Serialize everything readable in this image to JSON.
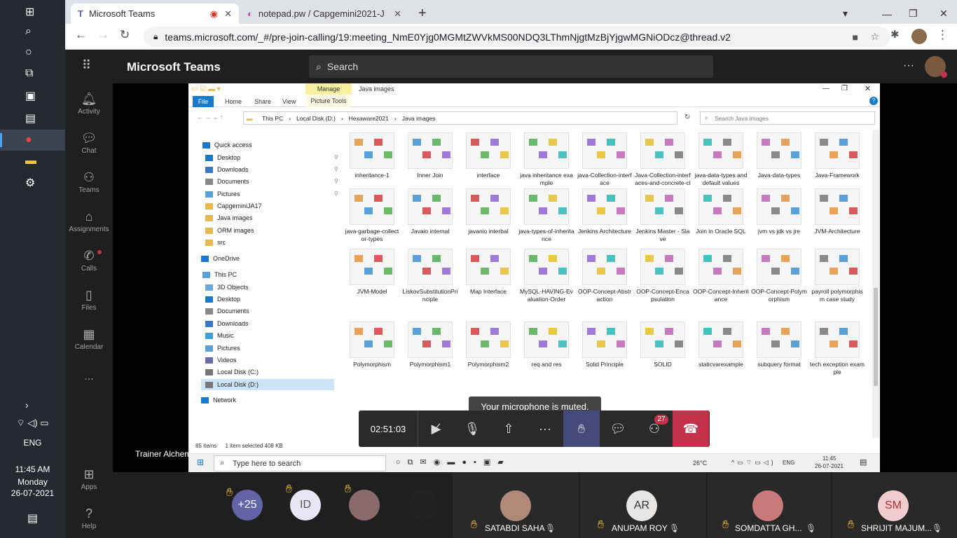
{
  "win_tray": {
    "lang": "ENG",
    "time": "11:45 AM",
    "day": "Monday",
    "date": "26-07-2021"
  },
  "chrome": {
    "tabs": [
      {
        "label": "Microsoft Teams"
      },
      {
        "label": "notepad.pw / Capgemini2021-JA"
      }
    ],
    "url": "teams.microsoft.com/_#/pre-join-calling/19:meeting_NmE0Yjg0MGMtZWVkMS00NDQ3LThmNjgtMzBjYjgwMGNiODcz@thread.v2"
  },
  "teams": {
    "brand": "Microsoft Teams",
    "search_placeholder": "Search",
    "rail": [
      {
        "label": "Activity"
      },
      {
        "label": "Chat"
      },
      {
        "label": "Teams"
      },
      {
        "label": "Assignments"
      },
      {
        "label": "Calls"
      },
      {
        "label": "Files"
      },
      {
        "label": "Calendar"
      },
      {
        "label": "..."
      },
      {
        "label": "Apps"
      },
      {
        "label": "Help"
      }
    ],
    "presenter": "Trainer Alchemy"
  },
  "explorer": {
    "ribbon_context": "Manage",
    "ribbon_title": "Java  images",
    "ribbon_tabs": [
      "File",
      "Home",
      "Share",
      "View",
      "Picture Tools"
    ],
    "breadcrumb": [
      "This PC",
      "Local Disk (D:)",
      "Hexaware2021",
      "Java  images"
    ],
    "search_placeholder": "Search Java  images",
    "nav": [
      "Quick access",
      "Desktop",
      "Downloads",
      "Documents",
      "Pictures",
      "CapgeminiJA17",
      "Java  images",
      "ORM images",
      "src",
      "OneDrive",
      "This PC",
      "3D Objects",
      "Desktop",
      "Documents",
      "Downloads",
      "Music",
      "Pictures",
      "Videos",
      "Local Disk (C:)",
      "Local Disk (D:)",
      "Network"
    ],
    "files": [
      "inheritance-1",
      "Inner Join",
      "interface",
      "java inheritance example",
      "java-Collection-interface",
      "Java-Collection-interfaces-and-concrete-classes",
      "java-data-types and default values",
      "Java-data-types",
      "Java-Framework",
      "java-garbage-collector-types",
      "Javaio internal",
      "javanio interbal",
      "java-types-of-inheritance",
      "Jenkins Architecture",
      "Jenkins Master - Slave",
      "Join in Oracle SQL",
      "jvm vs jdk vs jre",
      "JVM-Architecture",
      "JVM-Model",
      "LiskovSubstitutionPrinciple",
      "Map Interface",
      "MySQL-HAVING-Evaluation-Order",
      "OOP-Concept-Abstraction",
      "OOP-Concept-Encapsulation",
      "OOP-Concept-Inheritance",
      "OOP-Concept-Polymorphism",
      "payroll polymorphism case study",
      "Polymorphism",
      "Polymorphism1",
      "Polymorphism2",
      "req and res",
      "Solid Principle",
      "SOLID",
      "staticvarexample",
      "subquery format",
      "tech exception example"
    ],
    "status_items": "85 items",
    "status_selected": "1 item selected  408 KB",
    "taskbar_search": "Type here to search",
    "temp": "26°C",
    "lang": "ENG",
    "time": "11:45",
    "date": "26-07-2021"
  },
  "call": {
    "tooltip": "Your microphone is muted.",
    "duration": "02:51:03",
    "participants_badge": "27"
  },
  "participants": {
    "overflow": "+25",
    "id_initials": "ID",
    "tiles": [
      {
        "name": "SATABDI SAHA",
        "initials": ""
      },
      {
        "name": "ANUPAM ROY",
        "initials": "AR"
      },
      {
        "name": "SOMDATTA GH...",
        "initials": ""
      },
      {
        "name": "SHRIJIT MAJUM...",
        "initials": "SM"
      }
    ]
  }
}
